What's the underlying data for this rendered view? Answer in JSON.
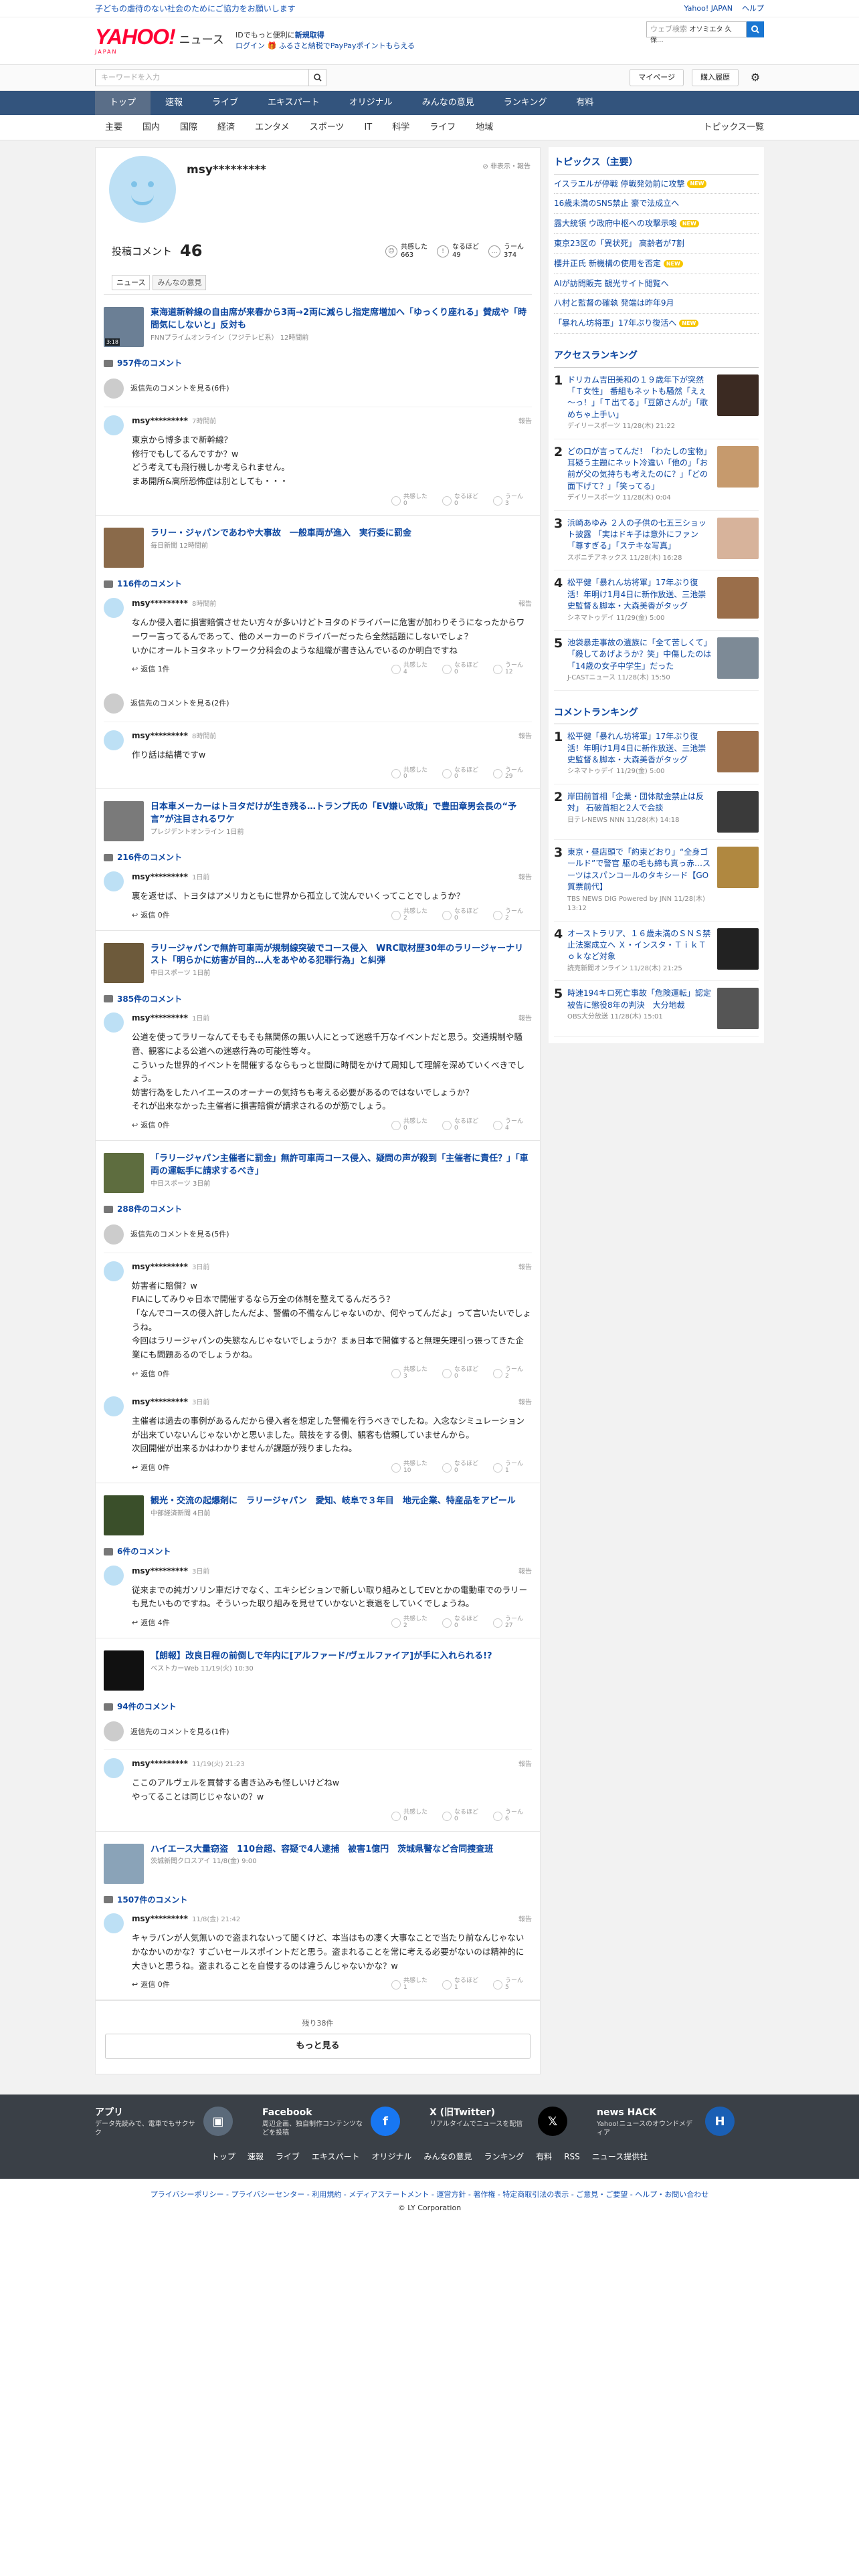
{
  "notice": "子どもの虐待のない社会のためにご協力をお願いします",
  "top_links": [
    "Yahoo! JAPAN",
    "ヘルプ"
  ],
  "search": {
    "placeholder": "ウェブ検索",
    "chip": "オソミエタ 久保...",
    "news_placeholder": "キーワードを入力"
  },
  "logo": {
    "yahoo": "YAHOO!",
    "japan": "JAPAN",
    "news": "ニュース"
  },
  "promo": {
    "line1": "IDでもっと便利に",
    "line1b": "新規取得",
    "login": "ログイン",
    "line2": "ふるさと納税でPayPayポイントもらえる"
  },
  "subbar": {
    "mypage": "マイページ",
    "history": "購入履歴"
  },
  "gnav": [
    "トップ",
    "速報",
    "ライブ",
    "エキスパート",
    "オリジナル",
    "みんなの意見",
    "ランキング",
    "有料"
  ],
  "cnav": [
    "主要",
    "国内",
    "国際",
    "経済",
    "エンタメ",
    "スポーツ",
    "IT",
    "科学",
    "ライフ",
    "地域"
  ],
  "cnav_right": "トピックス一覧",
  "profile": {
    "name": "msy*********",
    "links": "非表示・報告",
    "count_label": "投稿コメント",
    "count": "46",
    "reactions": [
      {
        "label": "共感した",
        "n": "663",
        "icon": "☺"
      },
      {
        "label": "なるほど",
        "n": "49",
        "icon": "!"
      },
      {
        "label": "うーん",
        "n": "374",
        "icon": "…"
      }
    ],
    "tabs": [
      "ニュース",
      "みんなの意見"
    ]
  },
  "articles": [
    {
      "title": "東海道新幹線の自由席が来春から3両→2両に減らし指定席増加へ「ゆっくり座れる」賛成や「時間気にしないと」反対も",
      "src": "FNNプライムオンライン（フジテレビ系） 12時間前",
      "thumb": "#6b7f95",
      "video": "3:18",
      "count": "957件のコメント",
      "other": "返信先のコメントを見る(6件)",
      "comments": [
        {
          "user": "msy*********",
          "date": "7時間前",
          "body": "東京から博多まで新幹線？\n修行でもしてるんですか？w\nどう考えても飛行機しか考えられません。\nまあ開所&高所恐怖症は別としても・・・",
          "reply": "",
          "r": [
            "0",
            "0",
            "3"
          ]
        }
      ]
    },
    {
      "title": "ラリー・ジャパンであわや大事故　一般車両が進入　実行委に罰金",
      "src": "毎日新聞 12時間前",
      "thumb": "#8a6a4a",
      "video": "",
      "count": "116件のコメント",
      "other": "",
      "comments": [
        {
          "user": "msy*********",
          "date": "8時間前",
          "body": "なんか侵入者に損害賠償させたい方々が多いけどトヨタのドライバーに危害が加わりそうになったからワーワー言ってるんであって、他のメーカーのドライバーだったら全然話題にしないでしょ？\nいかにオールトヨタネットワーク分科会のような組織が書き込んでいるのか明白ですね",
          "reply": "返信 1件",
          "r": [
            "4",
            "0",
            "12"
          ]
        }
      ],
      "other2": "返信先のコメントを見る(2件)",
      "comments2": [
        {
          "user": "msy*********",
          "date": "8時間前",
          "body": "作り話は結構ですw",
          "reply": "",
          "r": [
            "0",
            "0",
            "29"
          ]
        }
      ]
    },
    {
      "title": "日本車メーカーはトヨタだけが生き残る…トランプ氏の「EV嫌い政策」で豊田章男会長の“予言”が注目されるワケ",
      "src": "プレジデントオンライン 1日前",
      "thumb": "#7a7a7a",
      "video": "",
      "count": "216件のコメント",
      "other": "",
      "comments": [
        {
          "user": "msy*********",
          "date": "1日前",
          "body": "裏を返せば、トヨタはアメリカともに世界から孤立して沈んでいくってことでしょうか？",
          "reply": "返信 0件",
          "r": [
            "2",
            "0",
            "2"
          ]
        }
      ]
    },
    {
      "title": "ラリージャパンで無許可車両が規制線突破でコース侵入　WRC取材歴30年のラリージャーナリスト「明らかに妨害が目的…人をあやめる犯罪行為」と糾弾",
      "src": "中日スポーツ 1日前",
      "thumb": "#6d5a3b",
      "video": "",
      "count": "385件のコメント",
      "other": "",
      "comments": [
        {
          "user": "msy*********",
          "date": "1日前",
          "body": "公道を使ってラリーなんてそもそも無関係の無い人にとって迷惑千万なイベントだと思う。交通規制や騒音、観客による公道への迷惑行為の可能性等々。\nこういった世界的イベントを開催するならもっと世間に時間をかけて周知して理解を深めていくべきでしょう。\n妨害行為をしたハイエースのオーナーの気持ちも考える必要があるのではないでしょうか？\nそれが出来なかった主催者に損害賠償が請求されるのが筋でしょう。",
          "reply": "返信 0件",
          "r": [
            "0",
            "0",
            "4"
          ]
        }
      ]
    },
    {
      "title": "「ラリージャパン主催者に罰金」無許可車両コース侵入、疑問の声が殺到「主催者に責任？」「車両の運転手に請求するべき」",
      "src": "中日スポーツ 3日前",
      "thumb": "#5e6d3f",
      "video": "",
      "count": "288件のコメント",
      "other": "返信先のコメントを見る(5件)",
      "comments": [
        {
          "user": "msy*********",
          "date": "3日前",
          "body": "妨害者に賠償？w\nFIAにしてみりゃ日本で開催するなら万全の体制を整えてるんだろう？\n「なんでコースの侵入許したんだよ、警備の不備なんじゃないのか、何やってんだよ」って言いたいでしょうね。\n今回はラリージャパンの失態なんじゃないでしょうか？まぁ日本で開催すると無理矢理引っ張ってきた企業にも問題あるのでしょうかね。",
          "reply": "返信 0件",
          "r": [
            "3",
            "0",
            "2"
          ]
        },
        {
          "user": "msy*********",
          "date": "3日前",
          "body": "主催者は過去の事例があるんだから侵入者を想定した警備を行うべきでしたね。入念なシミュレーションが出来ていないんじゃないかと思いました。競技をする側、観客も信頼していませんから。\n次回開催が出来るかはわかりませんが課題が残りましたね。",
          "reply": "返信 0件",
          "r": [
            "10",
            "0",
            "1"
          ]
        }
      ]
    },
    {
      "title": "観光・交流の起爆剤に　ラリージャパン　愛知、岐阜で３年目　地元企業、特産品をアピール",
      "src": "中部経済新聞 4日前",
      "thumb": "#3a4f2a",
      "video": "",
      "count": "6件のコメント",
      "other": "",
      "comments": [
        {
          "user": "msy*********",
          "date": "3日前",
          "body": "従来までの純ガソリン車だけでなく、エキシビションで新しい取り組みとしてEVとかの電動車でのラリーも見たいものですね。そういった取り組みを見せていかないと衰退をしていくでしょうね。",
          "reply": "返信 4件",
          "r": [
            "2",
            "0",
            "27"
          ]
        }
      ]
    },
    {
      "title": "【朗報】改良日程の前倒しで年内に[アルファード/ヴェルファイア]が手に入れられる!?",
      "src": "ベストカーWeb 11/19(火) 10:30",
      "thumb": "#111111",
      "video": "",
      "count": "94件のコメント",
      "other": "返信先のコメントを見る(1件)",
      "comments": [
        {
          "user": "msy*********",
          "date": "11/19(火) 21:23",
          "body": "ここのアルヴェルを買替する書き込みも怪しいけどねw\nやってることは同じじゃないの？w",
          "reply": "",
          "r": [
            "0",
            "0",
            "6"
          ]
        }
      ]
    },
    {
      "title": "ハイエース大量窃盗　110台超、容疑で4人逮捕　被害1億円　茨城県警など合同捜査班",
      "src": "茨城新聞クロスアイ 11/8(金) 9:00",
      "thumb": "#8aa3b8",
      "video": "",
      "count": "1507件のコメント",
      "other": "",
      "comments": [
        {
          "user": "msy*********",
          "date": "11/8(金) 21:42",
          "body": "キャラバンが人気無いので盗まれないって聞くけど、本当はもの凄く大事なことで当たり前なんじゃないかなかいのかな？すごいセールスポイントだと思う。盗まれることを常に考える必要がないのは精神的に大きいと思うね。盗まれることを自慢するのは違うんじゃないかな？w",
          "reply": "返信 0件",
          "r": [
            "1",
            "1",
            "5"
          ]
        }
      ]
    }
  ],
  "remaining": "残り38件",
  "more": "もっと見る",
  "sidebar": {
    "topics_title": "トピックス（主要）",
    "topics": [
      {
        "t": "イスラエルが停戦 停戦発効前に攻撃",
        "n": true
      },
      {
        "t": "16歳未満のSNS禁止 豪で法成立へ",
        "n": false
      },
      {
        "t": "露大統領 ウ政府中枢への攻撃示唆",
        "n": true
      },
      {
        "t": "東京23区の「異状死」 高齢者が7割",
        "n": false
      },
      {
        "t": "櫻井正氏 新機構の使用を否定",
        "n": true
      },
      {
        "t": "AIが訪問販売 観光サイト閲覧へ",
        "n": false
      },
      {
        "t": "八村と監督の確執 発端は昨年9月",
        "n": false
      },
      {
        "t": "「暴れん坊将軍」17年ぶり復活へ",
        "n": true
      }
    ],
    "access_title": "アクセスランキング",
    "access": [
      {
        "t": "ドリカム吉田美和の１９歳年下が突然「Ｔ女性」 番組もネットも騒然「えぇ～っ！」「Ｔ出てる」「豆節さんが」「歌めちゃ上手い」",
        "s": "デイリースポーツ 11/28(木) 21:22",
        "c": "#3b2a22"
      },
      {
        "t": "どの口が言ってんだ！「わたしの宝物」耳疑う主題にネット冷違い「他の」「お前が父の気持ちも考えたのに？」「どの面下げて？」「笑ってる」",
        "s": "デイリースポーツ 11/28(木) 0:04",
        "c": "#c69a6d"
      },
      {
        "t": "浜崎あゆみ ２人の子供の七五三ショット披露 「実はドキ子は意外にファン「尊すぎる」「ステキな写真」",
        "s": "スポニチアネックス 11/28(木) 16:28",
        "c": "#d7b39b"
      },
      {
        "t": "松平健「暴れん坊将軍」17年ぶり復活！年明け1月4日に新作放送、三池崇史監督＆脚本・大森美香がタッグ",
        "s": "シネマトゥデイ 11/29(金) 5:00",
        "c": "#9a6e4a"
      },
      {
        "t": "池袋暴走事故の遺族に「全て苦しくて」「殺してあげようか？笑」中傷したのは「14歳の女子中学生」だった",
        "s": "J-CASTニュース 11/28(木) 15:50",
        "c": "#7d8a96"
      }
    ],
    "comment_title": "コメントランキング",
    "comment": [
      {
        "t": "松平健「暴れん坊将軍」17年ぶり復活！年明け1月4日に新作放送、三池崇史監督＆脚本・大森美香がタッグ",
        "s": "シネマトゥデイ 11/29(金) 5:00",
        "c": "#9a6e4a"
      },
      {
        "t": "岸田前首相「企業・団体献金禁止は反対」 石破首相と2人で会談",
        "s": "日テレNEWS NNN 11/28(木) 14:18",
        "c": "#3a3a3a"
      },
      {
        "t": "東京・昼店頭で「約束どおり」“全身ゴールド”で警官 駆の毛も締も真っ赤…スーツはスパンコールのタキシード【GO質票前代】",
        "s": "TBS NEWS DIG Powered by JNN 11/28(木) 13:12",
        "c": "#b08840"
      },
      {
        "t": "オーストラリア、１６歳未満のＳＮＳ禁止法案成立へ Ｘ・インスタ・ＴｉｋＴｏｋなど対象",
        "s": "読売新聞オンライン 11/28(木) 21:25",
        "c": "#222222"
      },
      {
        "t": "時速194キロ死亡事故「危険運転」認定　被告に懲役8年の判決　大分地裁",
        "s": "OBS大分放送 11/28(木) 15:01",
        "c": "#555555"
      }
    ]
  },
  "footer": {
    "apps": [
      {
        "name": "アプリ",
        "desc": "データ先読みで、電車でもサクサク",
        "ic": "▣",
        "bg": "#5b6a7a"
      },
      {
        "name": "Facebook",
        "desc": "周辺企画、独自制作コンテンツなどを投稿",
        "ic": "f",
        "bg": "#1877f2"
      },
      {
        "name": "X (旧Twitter)",
        "desc": "リアルタイムでニュースを配信",
        "ic": "𝕏",
        "bg": "#000000"
      },
      {
        "name": "news HACK",
        "desc": "Yahoo!ニュースのオウンドメディア",
        "ic": "H",
        "bg": "#1a5fb4"
      }
    ],
    "links": [
      "トップ",
      "速報",
      "ライブ",
      "エキスパート",
      "オリジナル",
      "みんなの意見",
      "ランキング",
      "有料",
      "RSS",
      "ニュース提供社"
    ],
    "legal": "プライバシーポリシー - プライバシーセンター - 利用規約 - メディアステートメント - 運営方針 - 著作権 - 特定商取引法の表示 - ご意見・ご要望 - ヘルプ・お問い合わせ",
    "copy": "© LY Corporation"
  }
}
